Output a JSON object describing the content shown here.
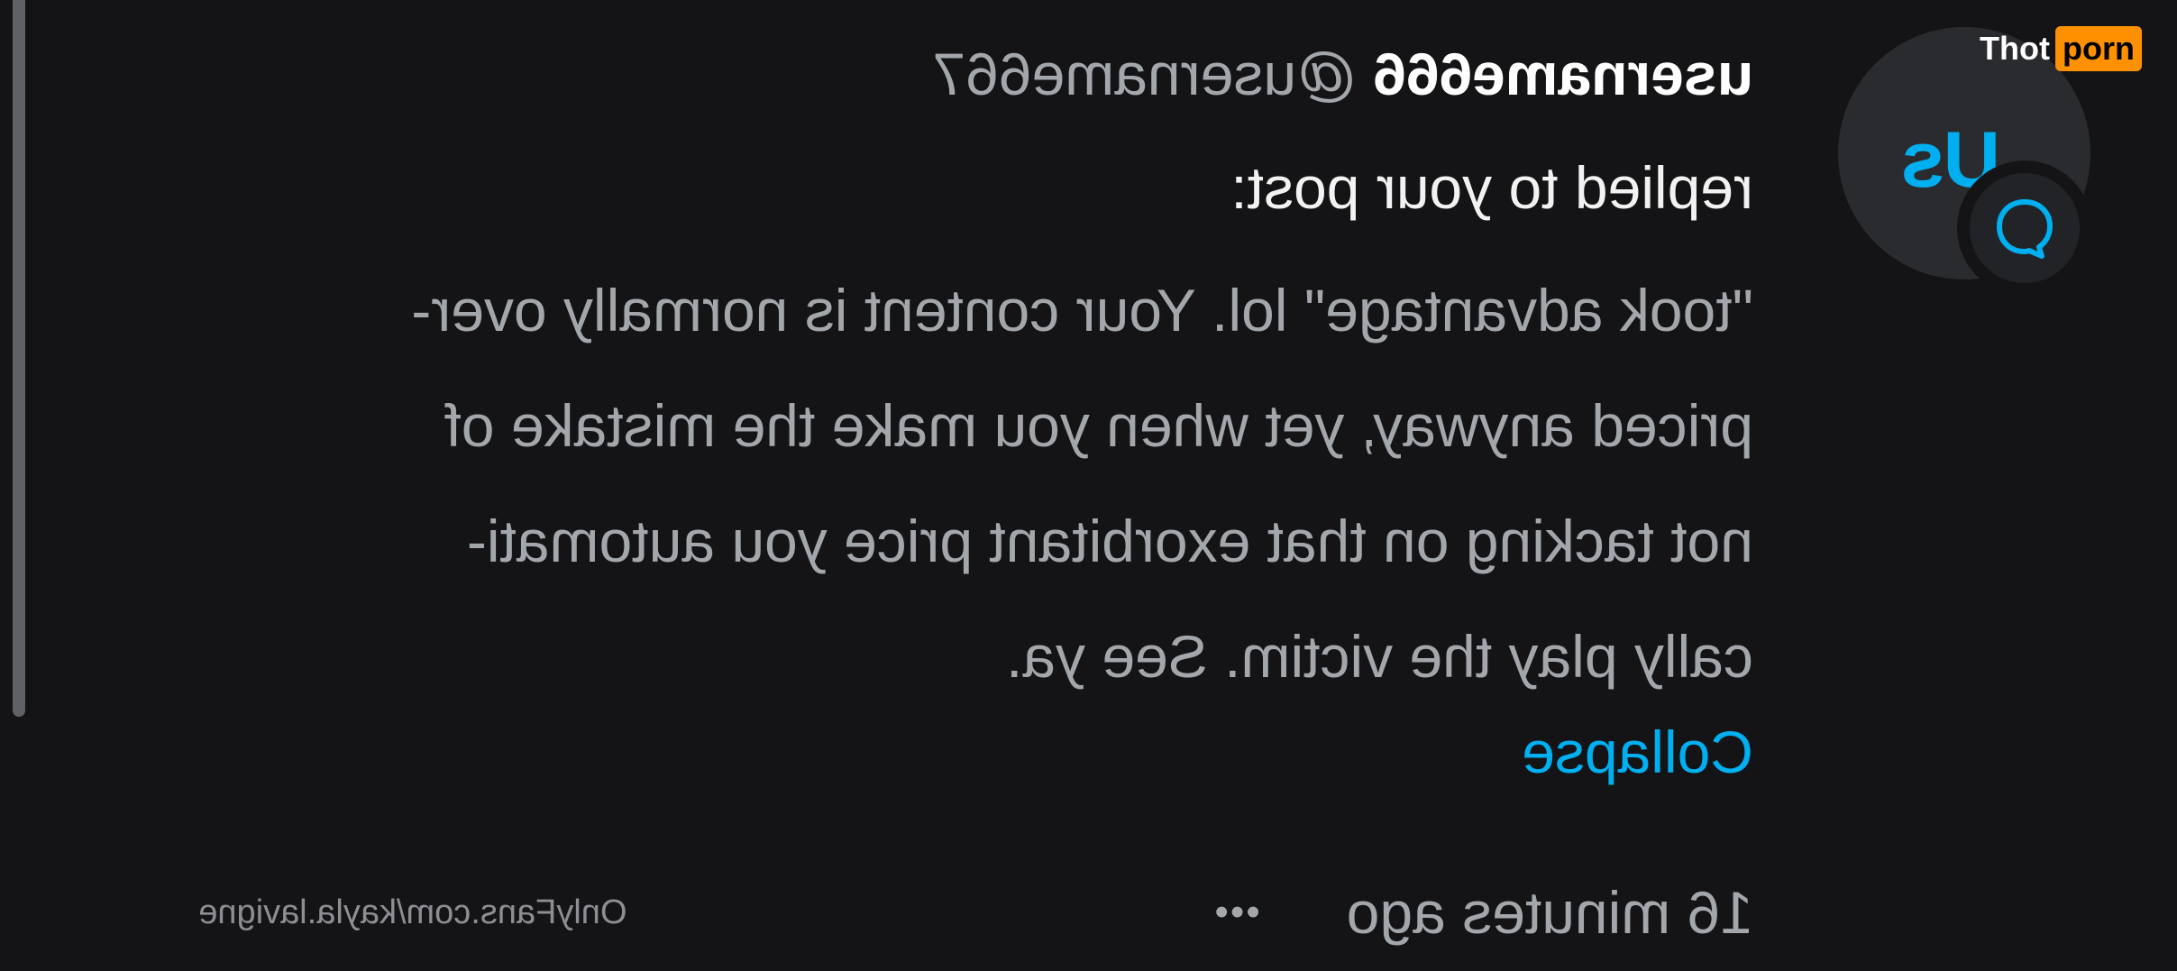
{
  "watermark": {
    "logo_part1": "Thot",
    "logo_part2": "porn",
    "url": "OnlyFans.com/kayla.lavigne"
  },
  "notification": {
    "avatar_initials": "Us",
    "badge_icon": "chat-bubble-icon",
    "username": "username666",
    "handle": "@username667",
    "action": "replied to your post:",
    "body_lines": [
      "\"took advantage\" lol. Your content is normally over-",
      "priced anyway, yet when you make the mistake of",
      "not tacking on that exorbitant price you automati-",
      "cally play the victim. See ya."
    ],
    "collapse_label": "Collapse",
    "time": "16 minutes ago",
    "more_label": "•••"
  },
  "colors": {
    "background": "#141416",
    "accent": "#00aff0",
    "secondary_text": "#a3a6ab",
    "logo_badge": "#ff9000"
  }
}
